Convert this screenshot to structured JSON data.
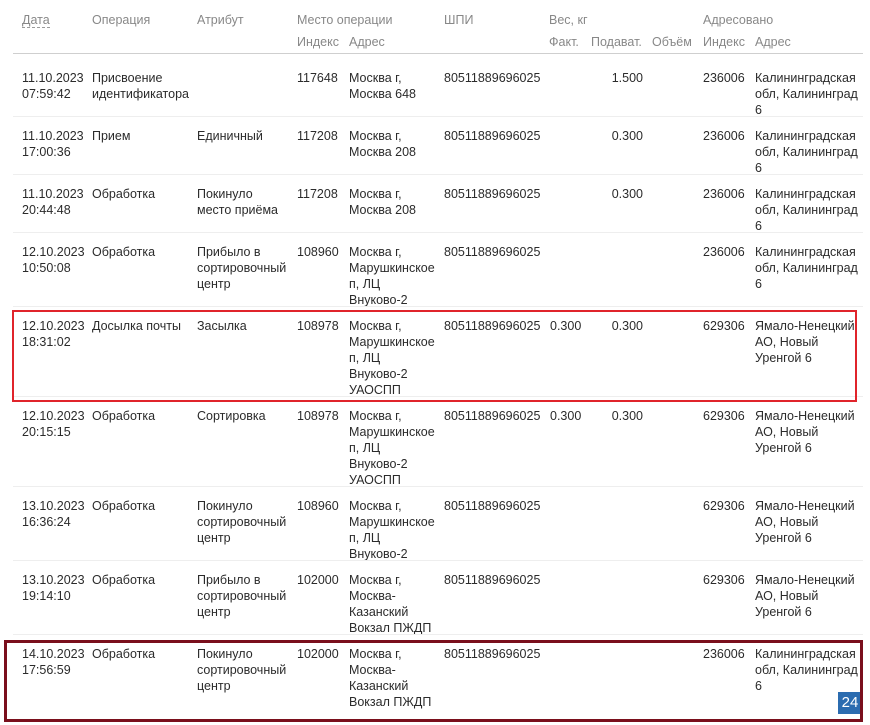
{
  "header": {
    "date": "Дата",
    "operation": "Операция",
    "attribute": "Атрибут",
    "place": "Место операции",
    "place_index": "Индекс",
    "place_address": "Адрес",
    "shpi": "ШПИ",
    "weight": "Вес, кг",
    "weight_fact": "Факт.",
    "weight_declared": "Подават.",
    "weight_volume": "Объём",
    "addressed": "Адресовано",
    "addr_index": "Индекс",
    "addr_address": "Адрес"
  },
  "rows": [
    {
      "date": [
        "11.10.2023",
        "07:59:42"
      ],
      "operation": [
        "Присвоение",
        "идентификатора"
      ],
      "attribute": [],
      "index": "117648",
      "address": [
        "Москва г,",
        "Москва 648"
      ],
      "shpi": "80511889696025",
      "fact": "",
      "declared": "1.500",
      "to_index": "236006",
      "to_address": [
        "Калининградская",
        "обл, Калининград",
        "6"
      ]
    },
    {
      "date": [
        "11.10.2023",
        "17:00:36"
      ],
      "operation": [
        "Прием"
      ],
      "attribute": [
        "Единичный"
      ],
      "index": "117208",
      "address": [
        "Москва г,",
        "Москва 208"
      ],
      "shpi": "80511889696025",
      "fact": "",
      "declared": "0.300",
      "to_index": "236006",
      "to_address": [
        "Калининградская",
        "обл, Калининград",
        "6"
      ]
    },
    {
      "date": [
        "11.10.2023",
        "20:44:48"
      ],
      "operation": [
        "Обработка"
      ],
      "attribute": [
        "Покинуло",
        "место приёма"
      ],
      "index": "117208",
      "address": [
        "Москва г,",
        "Москва 208"
      ],
      "shpi": "80511889696025",
      "fact": "",
      "declared": "0.300",
      "to_index": "236006",
      "to_address": [
        "Калининградская",
        "обл, Калининград",
        "6"
      ]
    },
    {
      "date": [
        "12.10.2023",
        "10:50:08"
      ],
      "operation": [
        "Обработка"
      ],
      "attribute": [
        "Прибыло в",
        "сортировочный",
        "центр"
      ],
      "index": "108960",
      "address": [
        "Москва г,",
        "Марушкинское",
        "п, ЛЦ",
        "Внуково-2"
      ],
      "shpi": "80511889696025",
      "fact": "",
      "declared": "",
      "to_index": "236006",
      "to_address": [
        "Калининградская",
        "обл, Калининград",
        "6"
      ]
    },
    {
      "date": [
        "12.10.2023",
        "18:31:02"
      ],
      "operation": [
        "Досылка почты"
      ],
      "attribute": [
        "Засылка"
      ],
      "index": "108978",
      "address": [
        "Москва г,",
        "Марушкинское",
        "п, ЛЦ",
        "Внуково-2",
        "УАОСПП"
      ],
      "shpi": "80511889696025",
      "fact": "0.300",
      "declared": "0.300",
      "to_index": "629306",
      "to_address": [
        "Ямало-Ненецкий",
        "АО, Новый",
        "Уренгой 6"
      ]
    },
    {
      "date": [
        "12.10.2023",
        "20:15:15"
      ],
      "operation": [
        "Обработка"
      ],
      "attribute": [
        "Сортировка"
      ],
      "index": "108978",
      "address": [
        "Москва г,",
        "Марушкинское",
        "п, ЛЦ",
        "Внуково-2",
        "УАОСПП"
      ],
      "shpi": "80511889696025",
      "fact": "0.300",
      "declared": "0.300",
      "to_index": "629306",
      "to_address": [
        "Ямало-Ненецкий",
        "АО, Новый",
        "Уренгой 6"
      ]
    },
    {
      "date": [
        "13.10.2023",
        "16:36:24"
      ],
      "operation": [
        "Обработка"
      ],
      "attribute": [
        "Покинуло",
        "сортировочный",
        "центр"
      ],
      "index": "108960",
      "address": [
        "Москва г,",
        "Марушкинское",
        "п, ЛЦ",
        "Внуково-2"
      ],
      "shpi": "80511889696025",
      "fact": "",
      "declared": "",
      "to_index": "629306",
      "to_address": [
        "Ямало-Ненецкий",
        "АО, Новый",
        "Уренгой 6"
      ]
    },
    {
      "date": [
        "13.10.2023",
        "19:14:10"
      ],
      "operation": [
        "Обработка"
      ],
      "attribute": [
        "Прибыло в",
        "сортировочный",
        "центр"
      ],
      "index": "102000",
      "address": [
        "Москва г,",
        "Москва-",
        "Казанский",
        "Вокзал ПЖДП"
      ],
      "shpi": "80511889696025",
      "fact": "",
      "declared": "",
      "to_index": "629306",
      "to_address": [
        "Ямало-Ненецкий",
        "АО, Новый",
        "Уренгой 6"
      ]
    },
    {
      "date": [
        "14.10.2023",
        "17:56:59"
      ],
      "operation": [
        "Обработка"
      ],
      "attribute": [
        "Покинуло",
        "сортировочный",
        "центр"
      ],
      "index": "102000",
      "address": [
        "Москва г,",
        "Москва-",
        "Казанский",
        "Вокзал ПЖДП"
      ],
      "shpi": "80511889696025",
      "fact": "",
      "declared": "",
      "to_index": "236006",
      "to_address": [
        "Калининградская",
        "обл, Калининград",
        "6"
      ]
    }
  ],
  "highlights": [
    {
      "row": 4,
      "color": "#e0242b"
    },
    {
      "row": 8,
      "color": "#7a0f1c"
    }
  ],
  "badge": "24"
}
